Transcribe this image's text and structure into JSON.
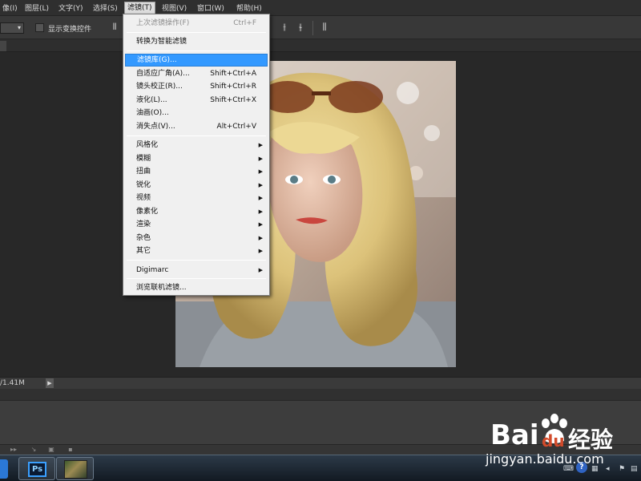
{
  "menubar": {
    "items": [
      "像(I)",
      "图层(L)",
      "文字(Y)",
      "选择(S)",
      "滤镜(T)",
      "视图(V)",
      "窗口(W)",
      "帮助(H)"
    ],
    "active_index": 4
  },
  "options_bar": {
    "select_arrow": "▾",
    "show_transform_label": "显示变换控件",
    "icons": [
      "align-left-icon",
      "distribute-center-icon",
      "distribute-right-icon",
      "distribute-middle-icon",
      "auto-align-icon"
    ]
  },
  "filter_menu": {
    "last_filter": {
      "label": "上次滤镜操作(F)",
      "shortcut": "Ctrl+F"
    },
    "smart_filter": {
      "label": "转换为智能滤镜"
    },
    "items_group1": [
      {
        "label": "滤镜库(G)...",
        "shortcut": ""
      },
      {
        "label": "自适应广角(A)...",
        "shortcut": "Shift+Ctrl+A"
      },
      {
        "label": "镜头校正(R)...",
        "shortcut": "Shift+Ctrl+R"
      },
      {
        "label": "液化(L)...",
        "shortcut": "Shift+Ctrl+X"
      },
      {
        "label": "油画(O)...",
        "shortcut": ""
      },
      {
        "label": "消失点(V)...",
        "shortcut": "Alt+Ctrl+V"
      }
    ],
    "submenus": [
      "风格化",
      "模糊",
      "扭曲",
      "锐化",
      "视频",
      "像素化",
      "渲染",
      "杂色",
      "其它"
    ],
    "digimarc": "Digimarc",
    "browse_online": "浏览联机滤镜...",
    "submenu_arrow": "▶",
    "highlight_color": "#3399ff"
  },
  "status": {
    "doc_size": "/1.41M",
    "arrow": "▶"
  },
  "taskbar": {
    "ps_label": "Ps",
    "help_glyph": "?"
  },
  "watermark": {
    "brand_a": "Bai",
    "brand_b": "du",
    "brand_c": "经验",
    "url": "jingyan.baidu.com"
  },
  "colors": {
    "menu_bg": "#f0f0f0",
    "workspace_bg": "#282828",
    "accent": "#3399ff"
  }
}
